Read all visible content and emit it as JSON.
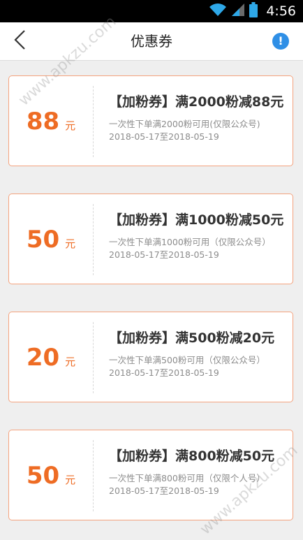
{
  "status_bar": {
    "time": "4:56",
    "icons": [
      "wifi-icon",
      "signal-icon",
      "battery-icon"
    ]
  },
  "header": {
    "title": "优惠券",
    "back_icon": "chevron-left-icon",
    "info_icon": "exclamation-circle-icon",
    "info_symbol": "!"
  },
  "watermarks": [
    "www.apkzu.com",
    "www.apkzu.com"
  ],
  "colors": {
    "accent": "#ee6c24",
    "border": "#f4a27d",
    "info": "#2f8fe6"
  },
  "coupons": [
    {
      "amount": "88",
      "unit": "元",
      "title": "【加粉券】满2000粉减88元",
      "desc": "一次性下单满2000粉可用(仅限公众号)",
      "date": "2018-05-17至2018-05-19"
    },
    {
      "amount": "50",
      "unit": "元",
      "title": "【加粉券】满1000粉减50元",
      "desc": "一次性下单满1000粉可用（仅限公众号）",
      "date": "2018-05-17至2018-05-19"
    },
    {
      "amount": "20",
      "unit": "元",
      "title": "【加粉券】满500粉减20元",
      "desc": "一次性下单满500粉可用（仅限公众号）",
      "date": "2018-05-17至2018-05-19"
    },
    {
      "amount": "50",
      "unit": "元",
      "title": "【加粉券】满800粉减50元",
      "desc": "一次性下单满800粉可用（仅限个人号）",
      "date": "2018-05-17至2018-05-19"
    }
  ]
}
